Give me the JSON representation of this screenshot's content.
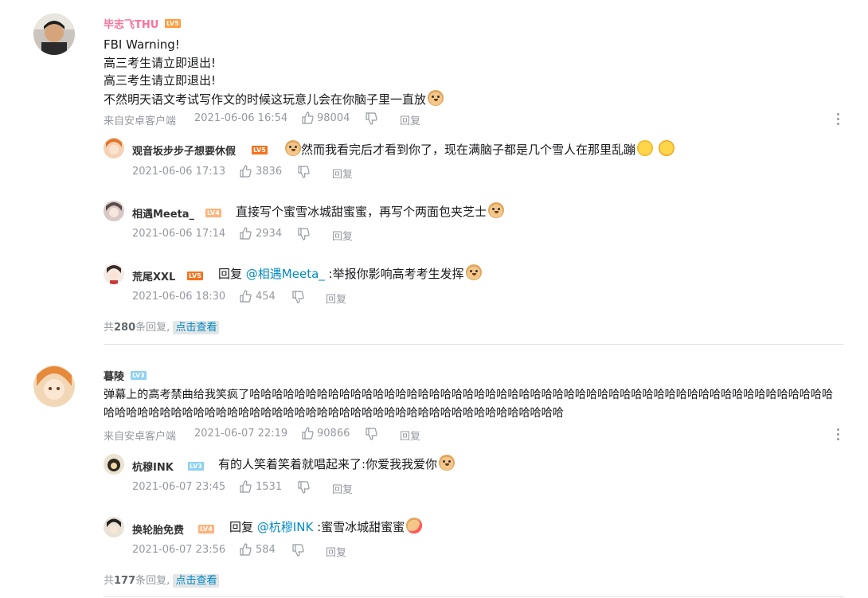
{
  "comments": [
    {
      "user": "毕志飞THU",
      "level": "LV5",
      "lines": [
        "FBI Warning!",
        "高三考生请立即退出!",
        "高三考生请立即退出!",
        "不然明天语文考试写作文的时候这玩意儿会在你脑子里一直放"
      ],
      "source": "来自安卓客户端",
      "time": "2021-06-06 16:54",
      "likes": "98004",
      "reply_label": "回复",
      "replies": [
        {
          "user": "观音坂步步子想要休假",
          "level": "LV5",
          "text": "然而我看完后才看到你了，现在满脑子都是几个雪人在那里乱蹦",
          "time": "2021-06-06 17:13",
          "likes": "3836"
        },
        {
          "user": "相遇Meeta_",
          "level": "LV4",
          "text": "直接写个蜜雪冰城甜蜜蜜，再写个两面包夹芝士",
          "time": "2021-06-06 17:14",
          "likes": "2934"
        },
        {
          "user": "荒尾XXL",
          "level": "LV5",
          "reply_prefix": "回复",
          "mention": "@相遇Meeta_",
          "text": ":举报你影响高考考生发挥",
          "time": "2021-06-06 18:30",
          "likes": "454"
        }
      ],
      "summary_prefix": "共",
      "summary_count": "280",
      "summary_suffix": "条回复,",
      "view_more": "点击查看"
    },
    {
      "user": "暮陵",
      "level": "LV3",
      "text": "弹幕上的高考禁曲给我笑疯了哈哈哈哈哈哈哈哈哈哈哈哈哈哈哈哈哈哈哈哈哈哈哈哈哈哈哈哈哈哈哈哈哈哈哈哈哈哈哈哈哈哈哈哈哈哈哈哈哈哈哈哈哈哈哈哈哈哈哈哈哈哈哈哈哈哈哈哈哈哈哈哈哈哈哈哈哈哈哈哈哈哈哈哈哈哈哈哈哈哈哈哈哈",
      "source": "来自安卓客户端",
      "time": "2021-06-07 22:19",
      "likes": "90866",
      "reply_label": "回复",
      "replies": [
        {
          "user": "杭穆INK",
          "level": "LV3",
          "text": "有的人笑着笑着就唱起来了:你爱我我爱你",
          "time": "2021-06-07 23:45",
          "likes": "1531"
        },
        {
          "user": "换轮胎免费",
          "level": "LV4",
          "reply_prefix": "回复",
          "mention": "@杭穆INK",
          "text": ":蜜雪冰城甜蜜蜜",
          "time": "2021-06-07 23:56",
          "likes": "584"
        }
      ],
      "summary_prefix": "共",
      "summary_count": "177",
      "summary_suffix": "条回复,",
      "view_more": "点击查看"
    }
  ],
  "colors": {
    "username_vip": "#fb7299",
    "link": "#008ac5",
    "meta": "#9499a0"
  },
  "icons": [
    "like-icon",
    "dislike-icon",
    "more-icon"
  ]
}
